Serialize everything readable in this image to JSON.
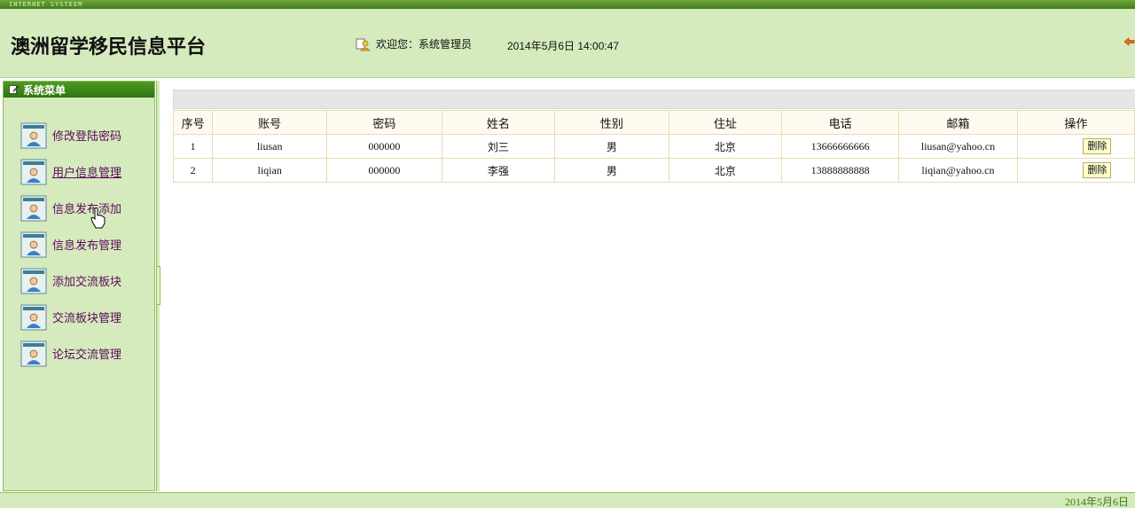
{
  "topbar": {
    "text": "INTERNET SYSTEEM"
  },
  "header": {
    "title": "澳洲留学移民信息平台",
    "welcome": "欢迎您：系统管理员",
    "datetime": "2014年5月6日  14:00:47"
  },
  "sidebar": {
    "title": "系统菜单",
    "items": [
      {
        "label": "修改登陆密码"
      },
      {
        "label": "用户信息管理"
      },
      {
        "label": "信息发布添加"
      },
      {
        "label": "信息发布管理"
      },
      {
        "label": "添加交流板块"
      },
      {
        "label": "交流板块管理"
      },
      {
        "label": "论坛交流管理"
      }
    ]
  },
  "table": {
    "headers": [
      "序号",
      "账号",
      "密码",
      "姓名",
      "性别",
      "住址",
      "电话",
      "邮箱",
      "操作"
    ],
    "rows": [
      {
        "seq": "1",
        "account": "liusan",
        "password": "000000",
        "name": "刘三",
        "gender": "男",
        "address": "北京",
        "phone": "13666666666",
        "email": "liusan@yahoo.cn",
        "action": "删除"
      },
      {
        "seq": "2",
        "account": "liqian",
        "password": "000000",
        "name": "李强",
        "gender": "男",
        "address": "北京",
        "phone": "13888888888",
        "email": "liqian@yahoo.cn",
        "action": "删除"
      }
    ]
  },
  "footer": {
    "date": "2014年5月6日"
  },
  "colors": {
    "header_bg": "#d5eabd",
    "menu_head": "#3f8518",
    "link": "#5c0a5c",
    "table_border": "#e8dcb0"
  }
}
